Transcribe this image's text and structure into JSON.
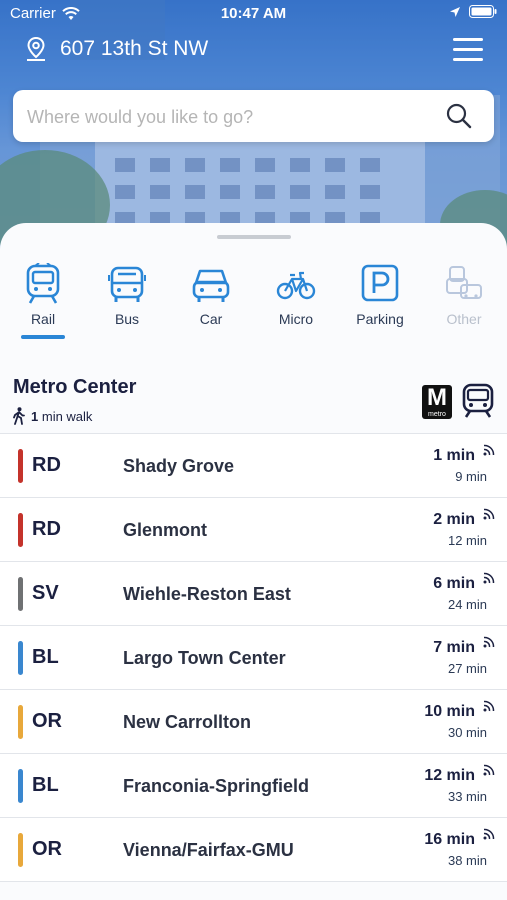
{
  "status_bar": {
    "carrier": "Carrier",
    "time": "10:47 AM"
  },
  "header": {
    "address": "607 13th St NW"
  },
  "search": {
    "placeholder": "Where would you like to go?"
  },
  "modes": [
    {
      "label": "Rail",
      "icon": "rail-icon",
      "selected": true
    },
    {
      "label": "Bus",
      "icon": "bus-icon"
    },
    {
      "label": "Car",
      "icon": "car-icon"
    },
    {
      "label": "Micro",
      "icon": "bike-icon"
    },
    {
      "label": "Parking",
      "icon": "parking-icon"
    },
    {
      "label": "Other",
      "icon": "other-icon",
      "disabled": true
    }
  ],
  "station": {
    "name": "Metro Center",
    "walk_minutes": "1",
    "walk_text": "min walk",
    "logo_letter": "M",
    "logo_text": "metro"
  },
  "arrivals": [
    {
      "line": "RD",
      "color": "#c4332b",
      "destination": "Shady Grove",
      "prediction": "1 min",
      "scheduled": "9 min"
    },
    {
      "line": "RD",
      "color": "#c4332b",
      "destination": "Glenmont",
      "prediction": "2 min",
      "scheduled": "12 min"
    },
    {
      "line": "SV",
      "color": "#6f7173",
      "destination": "Wiehle-Reston East",
      "prediction": "6 min",
      "scheduled": "24 min"
    },
    {
      "line": "BL",
      "color": "#3a87cf",
      "destination": "Largo Town Center",
      "prediction": "7 min",
      "scheduled": "27 min"
    },
    {
      "line": "OR",
      "color": "#e8a83b",
      "destination": "New Carrollton",
      "prediction": "10 min",
      "scheduled": "30 min"
    },
    {
      "line": "BL",
      "color": "#3a87cf",
      "destination": "Franconia-Springfield",
      "prediction": "12 min",
      "scheduled": "33 min"
    },
    {
      "line": "OR",
      "color": "#e8a83b",
      "destination": "Vienna/Fairfax-GMU",
      "prediction": "16 min",
      "scheduled": "38 min"
    }
  ],
  "colors": {
    "accent": "#2a86d6",
    "text_dark": "#1b2040"
  }
}
